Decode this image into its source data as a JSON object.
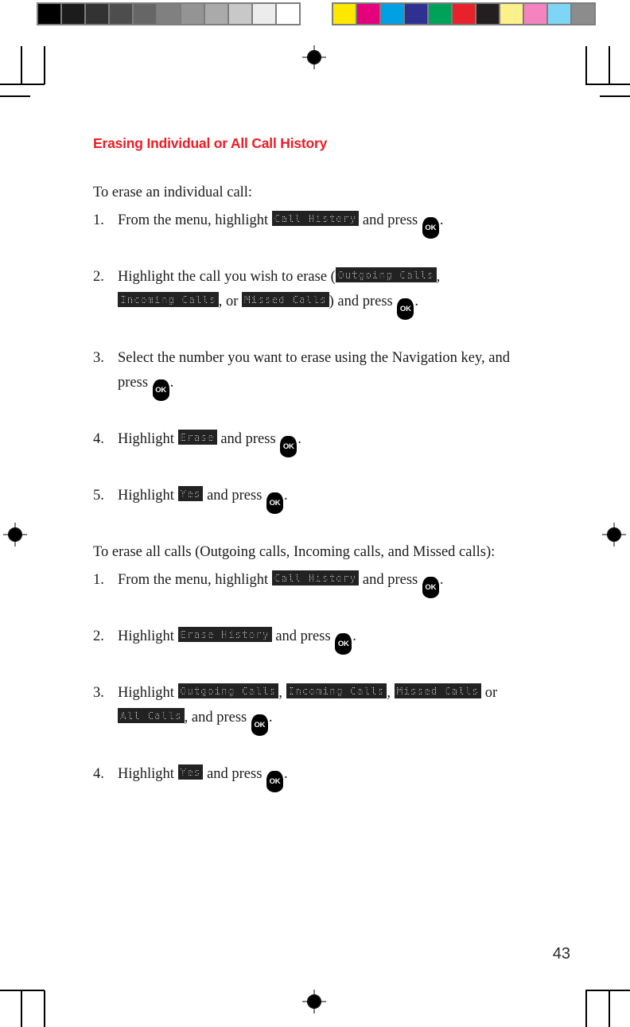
{
  "document": {
    "page_number": "43",
    "title": "Erasing Individual or All Call History",
    "title_color": "#ed1c24"
  },
  "calibration": {
    "grayscale_bar": {
      "name": "grayscale-calibration-bar",
      "swatches": [
        "#000000",
        "#1c1c1c",
        "#333333",
        "#4d4d4d",
        "#666666",
        "#808080",
        "#949494",
        "#aaaaaa",
        "#c8c8c8",
        "#ececec",
        "#ffffff"
      ]
    },
    "color_bar": {
      "name": "color-calibration-bar",
      "swatches": [
        "#ffe800",
        "#e5007d",
        "#00a0e4",
        "#2e3191",
        "#00a25a",
        "#e8222a",
        "#231f20",
        "#fcf08a",
        "#f583bf",
        "#7ed5f5",
        "#8c8c8c"
      ]
    }
  },
  "sections": [
    {
      "lead": "To erase an individual call:",
      "steps": [
        {
          "num": "1.",
          "parts": [
            {
              "type": "text",
              "value": "From the menu, highlight "
            },
            {
              "type": "lcd",
              "value": "Call History"
            },
            {
              "type": "text",
              "value": " and press "
            },
            {
              "type": "key",
              "value": "OK"
            },
            {
              "type": "text",
              "value": "."
            }
          ]
        },
        {
          "num": "2.",
          "parts": [
            {
              "type": "text",
              "value": "Highlight the call you wish to erase ("
            },
            {
              "type": "lcd",
              "value": "Outgoing Calls"
            },
            {
              "type": "text",
              "value": ", "
            },
            {
              "type": "lcd",
              "value": "Incoming Calls"
            },
            {
              "type": "text",
              "value": ", or "
            },
            {
              "type": "lcd",
              "value": "Missed Calls"
            },
            {
              "type": "text",
              "value": ")  and press "
            },
            {
              "type": "key",
              "value": "OK"
            },
            {
              "type": "text",
              "value": "."
            }
          ]
        },
        {
          "num": "3.",
          "parts": [
            {
              "type": "text",
              "value": "Select the number you want to erase using the Navigation key, and press "
            },
            {
              "type": "key",
              "value": "OK"
            },
            {
              "type": "text",
              "value": "."
            }
          ]
        },
        {
          "num": "4.",
          "parts": [
            {
              "type": "text",
              "value": "Highlight "
            },
            {
              "type": "lcd",
              "value": "Erase"
            },
            {
              "type": "text",
              "value": " and press "
            },
            {
              "type": "key",
              "value": "OK"
            },
            {
              "type": "text",
              "value": "."
            }
          ]
        },
        {
          "num": "5.",
          "parts": [
            {
              "type": "text",
              "value": "Highlight "
            },
            {
              "type": "lcd",
              "value": "Yes"
            },
            {
              "type": "text",
              "value": " and press "
            },
            {
              "type": "key",
              "value": "OK"
            },
            {
              "type": "text",
              "value": "."
            }
          ]
        }
      ]
    },
    {
      "lead": "To erase all calls (Outgoing calls, Incoming calls, and Missed calls):",
      "steps": [
        {
          "num": "1.",
          "parts": [
            {
              "type": "text",
              "value": "From the menu, highlight "
            },
            {
              "type": "lcd",
              "value": "Call History"
            },
            {
              "type": "text",
              "value": " and press "
            },
            {
              "type": "key",
              "value": "OK"
            },
            {
              "type": "text",
              "value": "."
            }
          ]
        },
        {
          "num": "2.",
          "parts": [
            {
              "type": "text",
              "value": "Highlight "
            },
            {
              "type": "lcd",
              "value": "Erase History"
            },
            {
              "type": "text",
              "value": " and press "
            },
            {
              "type": "key",
              "value": "OK"
            },
            {
              "type": "text",
              "value": "."
            }
          ]
        },
        {
          "num": "3.",
          "parts": [
            {
              "type": "text",
              "value": "Highlight "
            },
            {
              "type": "lcd",
              "value": "Outgoing Calls"
            },
            {
              "type": "text",
              "value": ", "
            },
            {
              "type": "lcd",
              "value": "Incoming Calls"
            },
            {
              "type": "text",
              "value": ", "
            },
            {
              "type": "lcd",
              "value": "Missed Calls"
            },
            {
              "type": "text",
              "value": " or "
            },
            {
              "type": "lcd",
              "value": "All Calls"
            },
            {
              "type": "text",
              "value": ", and press "
            },
            {
              "type": "key",
              "value": "OK"
            },
            {
              "type": "text",
              "value": "."
            }
          ]
        },
        {
          "num": "4.",
          "parts": [
            {
              "type": "text",
              "value": "Highlight "
            },
            {
              "type": "lcd",
              "value": "Yes"
            },
            {
              "type": "text",
              "value": " and press "
            },
            {
              "type": "key",
              "value": "OK"
            },
            {
              "type": "text",
              "value": "."
            }
          ]
        }
      ]
    }
  ]
}
